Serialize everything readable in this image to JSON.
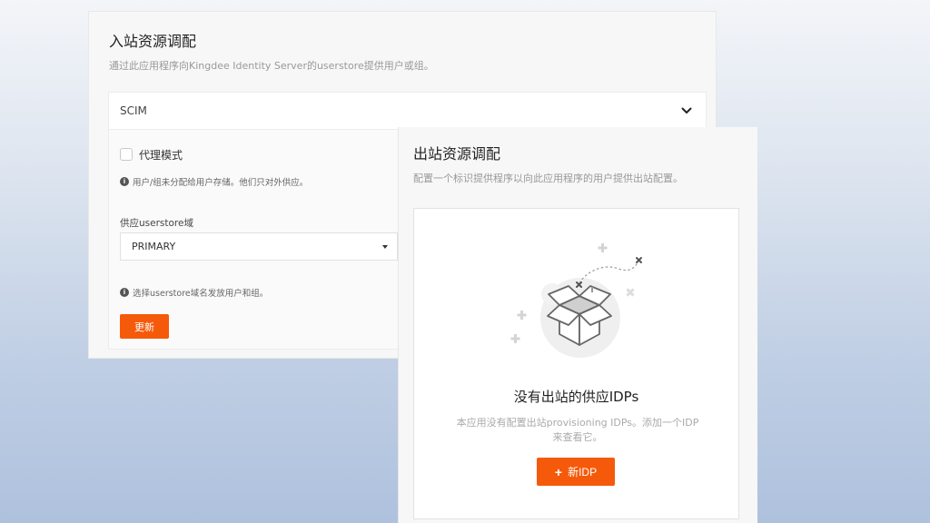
{
  "inbound": {
    "title": "入站资源调配",
    "description": "通过此应用程序向Kingdee Identity Server的userstore提供用户或组。",
    "protocol": {
      "selected": "SCIM",
      "chevron_icon": "chevron-down-icon"
    },
    "proxy_mode": {
      "label": "代理模式",
      "checked": false,
      "hint": "用户/组未分配给用户存储。他们只对外供应。"
    },
    "userstore": {
      "label": "供应userstore域",
      "selected": "PRIMARY",
      "hint": "选择userstore域名发放用户和组。"
    },
    "update_button": "更新"
  },
  "outbound": {
    "title": "出站资源调配",
    "description": "配置一个标识提供程序以向此应用程序的用户提供出站配置。",
    "empty_state": {
      "illustration": "empty-box-illustration",
      "title": "没有出站的供应IDPs",
      "desc_line1": "本应用没有配置出站provisioning IDPs。添加一个IDP",
      "desc_line2": "来查看它。",
      "button_icon": "+",
      "button_label": "新IDP"
    }
  },
  "colors": {
    "accent": "#f55a0a",
    "panel_bg": "#f7f7f7",
    "muted_text": "#999999"
  }
}
